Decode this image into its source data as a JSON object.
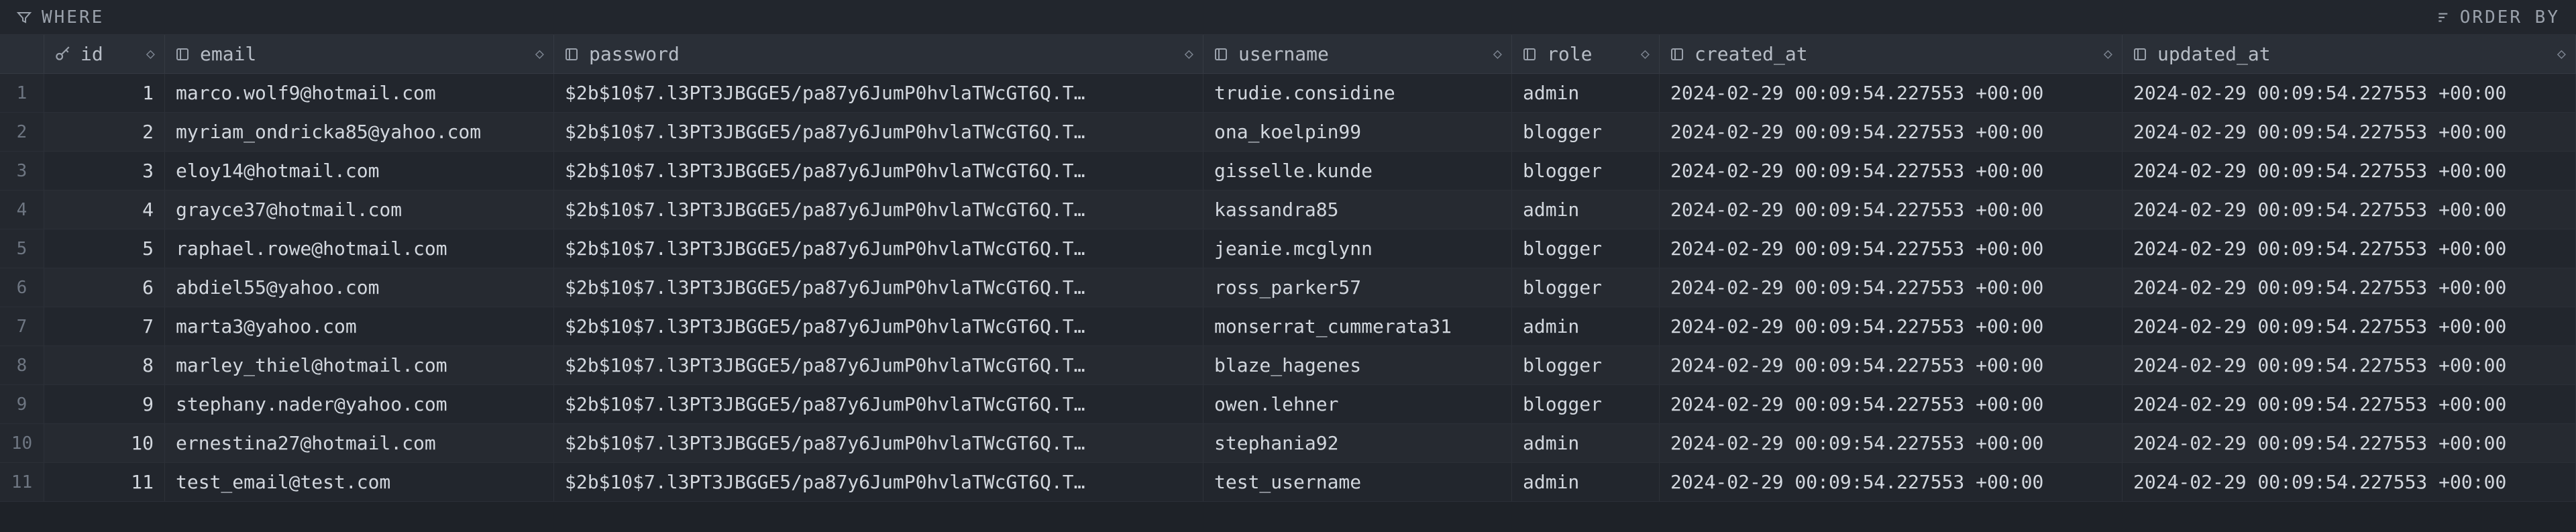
{
  "topbar": {
    "where_label": "WHERE",
    "orderby_label": "ORDER BY"
  },
  "columns": [
    {
      "key": "id",
      "label": "id",
      "cls": "c-id",
      "icon": "key",
      "num": true
    },
    {
      "key": "email",
      "label": "email",
      "cls": "c-em",
      "icon": "col",
      "num": false
    },
    {
      "key": "password",
      "label": "password",
      "cls": "c-pw",
      "icon": "col",
      "num": false
    },
    {
      "key": "username",
      "label": "username",
      "cls": "c-un",
      "icon": "col",
      "num": false
    },
    {
      "key": "role",
      "label": "role",
      "cls": "c-rl",
      "icon": "col",
      "num": false
    },
    {
      "key": "created_at",
      "label": "created_at",
      "cls": "c-ca",
      "icon": "col",
      "num": false
    },
    {
      "key": "updated_at",
      "label": "updated_at",
      "cls": "c-ua",
      "icon": "col",
      "num": false
    }
  ],
  "rows": [
    {
      "n": 1,
      "id": "1",
      "email": "marco.wolf9@hotmail.com",
      "password": "$2b$10$7.l3PT3JBGGE5/pa87y6JumP0hvlaTWcGT6Q.T…",
      "username": "trudie.considine",
      "role": "admin",
      "created_at": "2024-02-29 00:09:54.227553 +00:00",
      "updated_at": "2024-02-29 00:09:54.227553 +00:00"
    },
    {
      "n": 2,
      "id": "2",
      "email": "myriam_ondricka85@yahoo.com",
      "password": "$2b$10$7.l3PT3JBGGE5/pa87y6JumP0hvlaTWcGT6Q.T…",
      "username": "ona_koelpin99",
      "role": "blogger",
      "created_at": "2024-02-29 00:09:54.227553 +00:00",
      "updated_at": "2024-02-29 00:09:54.227553 +00:00"
    },
    {
      "n": 3,
      "id": "3",
      "email": "eloy14@hotmail.com",
      "password": "$2b$10$7.l3PT3JBGGE5/pa87y6JumP0hvlaTWcGT6Q.T…",
      "username": "gisselle.kunde",
      "role": "blogger",
      "created_at": "2024-02-29 00:09:54.227553 +00:00",
      "updated_at": "2024-02-29 00:09:54.227553 +00:00"
    },
    {
      "n": 4,
      "id": "4",
      "email": "grayce37@hotmail.com",
      "password": "$2b$10$7.l3PT3JBGGE5/pa87y6JumP0hvlaTWcGT6Q.T…",
      "username": "kassandra85",
      "role": "admin",
      "created_at": "2024-02-29 00:09:54.227553 +00:00",
      "updated_at": "2024-02-29 00:09:54.227553 +00:00"
    },
    {
      "n": 5,
      "id": "5",
      "email": "raphael.rowe@hotmail.com",
      "password": "$2b$10$7.l3PT3JBGGE5/pa87y6JumP0hvlaTWcGT6Q.T…",
      "username": "jeanie.mcglynn",
      "role": "blogger",
      "created_at": "2024-02-29 00:09:54.227553 +00:00",
      "updated_at": "2024-02-29 00:09:54.227553 +00:00"
    },
    {
      "n": 6,
      "id": "6",
      "email": "abdiel55@yahoo.com",
      "password": "$2b$10$7.l3PT3JBGGE5/pa87y6JumP0hvlaTWcGT6Q.T…",
      "username": "ross_parker57",
      "role": "blogger",
      "created_at": "2024-02-29 00:09:54.227553 +00:00",
      "updated_at": "2024-02-29 00:09:54.227553 +00:00"
    },
    {
      "n": 7,
      "id": "7",
      "email": "marta3@yahoo.com",
      "password": "$2b$10$7.l3PT3JBGGE5/pa87y6JumP0hvlaTWcGT6Q.T…",
      "username": "monserrat_cummerata31",
      "role": "admin",
      "created_at": "2024-02-29 00:09:54.227553 +00:00",
      "updated_at": "2024-02-29 00:09:54.227553 +00:00"
    },
    {
      "n": 8,
      "id": "8",
      "email": "marley_thiel@hotmail.com",
      "password": "$2b$10$7.l3PT3JBGGE5/pa87y6JumP0hvlaTWcGT6Q.T…",
      "username": "blaze_hagenes",
      "role": "blogger",
      "created_at": "2024-02-29 00:09:54.227553 +00:00",
      "updated_at": "2024-02-29 00:09:54.227553 +00:00"
    },
    {
      "n": 9,
      "id": "9",
      "email": "stephany.nader@yahoo.com",
      "password": "$2b$10$7.l3PT3JBGGE5/pa87y6JumP0hvlaTWcGT6Q.T…",
      "username": "owen.lehner",
      "role": "blogger",
      "created_at": "2024-02-29 00:09:54.227553 +00:00",
      "updated_at": "2024-02-29 00:09:54.227553 +00:00"
    },
    {
      "n": 10,
      "id": "10",
      "email": "ernestina27@hotmail.com",
      "password": "$2b$10$7.l3PT3JBGGE5/pa87y6JumP0hvlaTWcGT6Q.T…",
      "username": "stephania92",
      "role": "admin",
      "created_at": "2024-02-29 00:09:54.227553 +00:00",
      "updated_at": "2024-02-29 00:09:54.227553 +00:00"
    },
    {
      "n": 11,
      "id": "11",
      "email": "test_email@test.com",
      "password": "$2b$10$7.l3PT3JBGGE5/pa87y6JumP0hvlaTWcGT6Q.T…",
      "username": "test_username",
      "role": "admin",
      "created_at": "2024-02-29 00:09:54.227553 +00:00",
      "updated_at": "2024-02-29 00:09:54.227553 +00:00"
    }
  ]
}
